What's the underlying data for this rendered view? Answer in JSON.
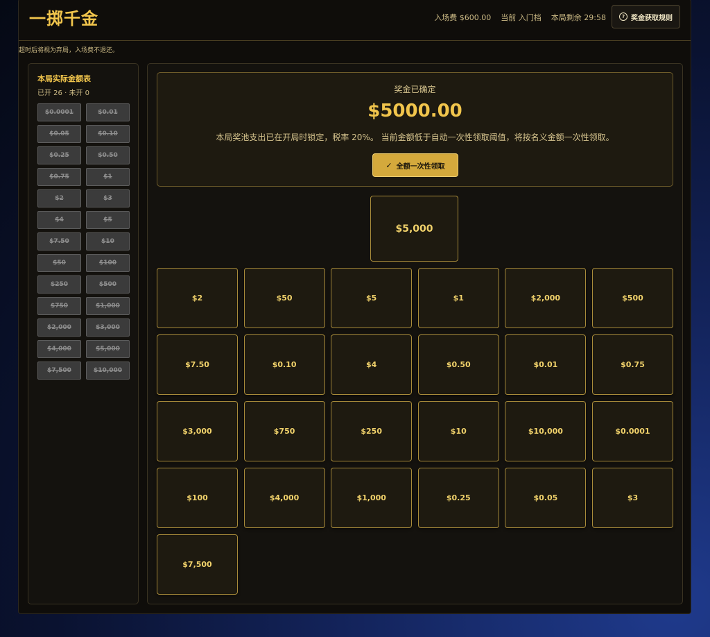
{
  "header": {
    "title": "一掷千金",
    "entry_fee": "入场费 $600.00",
    "current_tier": "当前 入门档",
    "time_left": "本局剩余 29:58",
    "rules_button": "奖金获取规则"
  },
  "notice": "超时后将视为弃局，入场费不退还。",
  "sidebar": {
    "title": "本局实际金额表",
    "status": "已开 26 · 未开 0",
    "amounts": [
      "$0.0001",
      "$0.01",
      "$0.05",
      "$0.10",
      "$0.25",
      "$0.50",
      "$0.75",
      "$1",
      "$2",
      "$3",
      "$4",
      "$5",
      "$7.50",
      "$10",
      "$50",
      "$100",
      "$250",
      "$500",
      "$750",
      "$1,000",
      "$2,000",
      "$3,000",
      "$4,000",
      "$5,000",
      "$7,500",
      "$10,000"
    ]
  },
  "result": {
    "label": "奖金已确定",
    "amount": "$5000.00",
    "description": "本局奖池支出已在开局时锁定，税率 20%。 当前金额低于自动一次性领取阈值，将按名义金额一次性领取。",
    "claim_button": "全额一次性领取"
  },
  "selected_case": "$5,000",
  "cases": [
    "$2",
    "$50",
    "$5",
    "$1",
    "$2,000",
    "$500",
    "$7.50",
    "$0.10",
    "$4",
    "$0.50",
    "$0.01",
    "$0.75",
    "$3,000",
    "$750",
    "$250",
    "$10",
    "$10,000",
    "$0.0001",
    "$100",
    "$4,000",
    "$1,000",
    "$0.25",
    "$0.05",
    "$3",
    "$7,500"
  ],
  "colors": {
    "accent": "#f1c54c",
    "button": "#d4a93c",
    "opened_chip": "#3b3b3b"
  }
}
